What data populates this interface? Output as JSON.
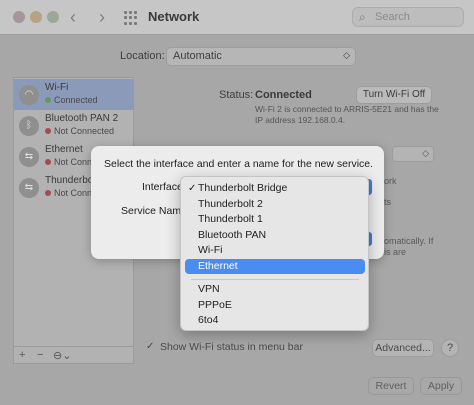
{
  "window": {
    "title": "Network",
    "search_placeholder": "Search",
    "back_glyph": "‹",
    "forward_glyph": "›"
  },
  "location": {
    "label": "Location:",
    "value": "Automatic"
  },
  "services": [
    {
      "name": "Wi-Fi",
      "status": "Connected",
      "icon": "wifi-icon",
      "selected": true
    },
    {
      "name": "Bluetooth PAN 2",
      "status": "Not Connected",
      "icon": "bluetooth-icon",
      "selected": false
    },
    {
      "name": "Ethernet",
      "status": "Not Connected",
      "icon": "ethernet-icon",
      "selected": false
    },
    {
      "name": "Thunderbolt",
      "status": "Not Conn",
      "icon": "thunderbolt-icon",
      "selected": false
    }
  ],
  "sidebar_controls": {
    "add": "+",
    "remove": "−",
    "action": "⊖⌄"
  },
  "status": {
    "label": "Status:",
    "value": "Connected",
    "button": "Turn Wi-Fi Off",
    "description": "Wi-Fi 2 is connected to ARRIS-5E21 and has the IP address 192.168.0.4."
  },
  "background_fragments": {
    "f1": "ork",
    "f2": "ts",
    "f3": "omatically. If",
    "f4": "is are"
  },
  "footer": {
    "show_wifi": "Show Wi-Fi status in menu bar",
    "advanced": "Advanced...",
    "help": "?",
    "revert": "Revert",
    "apply": "Apply"
  },
  "sheet": {
    "prompt": "Select the interface and enter a name for the new service.",
    "interface_label": "Interface",
    "service_name_label": "Service Name"
  },
  "interface_menu": {
    "group1": [
      {
        "label": "Thunderbolt Bridge",
        "checked": true
      },
      {
        "label": "Thunderbolt 2",
        "checked": false
      },
      {
        "label": "Thunderbolt 1",
        "checked": false
      },
      {
        "label": "Bluetooth PAN",
        "checked": false
      },
      {
        "label": "Wi-Fi",
        "checked": false
      },
      {
        "label": "Ethernet",
        "checked": false,
        "highlighted": true
      }
    ],
    "group2": [
      {
        "label": "VPN"
      },
      {
        "label": "PPPoE"
      },
      {
        "label": "6to4"
      }
    ],
    "check_glyph": "✓",
    "highlight_color": "#4a8cf2"
  }
}
